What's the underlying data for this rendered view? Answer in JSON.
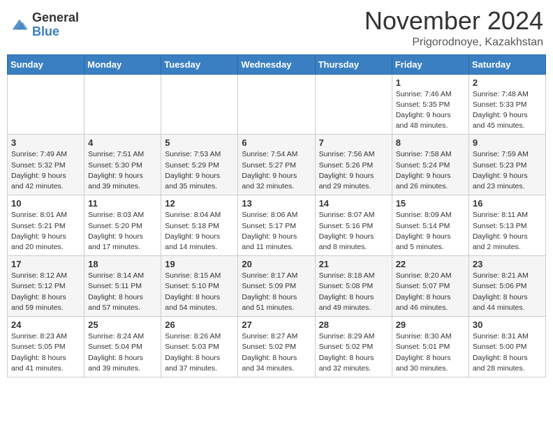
{
  "logo": {
    "general": "General",
    "blue": "Blue"
  },
  "title": "November 2024",
  "location": "Prigorodnoye, Kazakhstan",
  "days_of_week": [
    "Sunday",
    "Monday",
    "Tuesday",
    "Wednesday",
    "Thursday",
    "Friday",
    "Saturday"
  ],
  "weeks": [
    [
      {
        "day": "",
        "info": ""
      },
      {
        "day": "",
        "info": ""
      },
      {
        "day": "",
        "info": ""
      },
      {
        "day": "",
        "info": ""
      },
      {
        "day": "",
        "info": ""
      },
      {
        "day": "1",
        "info": "Sunrise: 7:46 AM\nSunset: 5:35 PM\nDaylight: 9 hours and 48 minutes."
      },
      {
        "day": "2",
        "info": "Sunrise: 7:48 AM\nSunset: 5:33 PM\nDaylight: 9 hours and 45 minutes."
      }
    ],
    [
      {
        "day": "3",
        "info": "Sunrise: 7:49 AM\nSunset: 5:32 PM\nDaylight: 9 hours and 42 minutes."
      },
      {
        "day": "4",
        "info": "Sunrise: 7:51 AM\nSunset: 5:30 PM\nDaylight: 9 hours and 39 minutes."
      },
      {
        "day": "5",
        "info": "Sunrise: 7:53 AM\nSunset: 5:29 PM\nDaylight: 9 hours and 35 minutes."
      },
      {
        "day": "6",
        "info": "Sunrise: 7:54 AM\nSunset: 5:27 PM\nDaylight: 9 hours and 32 minutes."
      },
      {
        "day": "7",
        "info": "Sunrise: 7:56 AM\nSunset: 5:26 PM\nDaylight: 9 hours and 29 minutes."
      },
      {
        "day": "8",
        "info": "Sunrise: 7:58 AM\nSunset: 5:24 PM\nDaylight: 9 hours and 26 minutes."
      },
      {
        "day": "9",
        "info": "Sunrise: 7:59 AM\nSunset: 5:23 PM\nDaylight: 9 hours and 23 minutes."
      }
    ],
    [
      {
        "day": "10",
        "info": "Sunrise: 8:01 AM\nSunset: 5:21 PM\nDaylight: 9 hours and 20 minutes."
      },
      {
        "day": "11",
        "info": "Sunrise: 8:03 AM\nSunset: 5:20 PM\nDaylight: 9 hours and 17 minutes."
      },
      {
        "day": "12",
        "info": "Sunrise: 8:04 AM\nSunset: 5:18 PM\nDaylight: 9 hours and 14 minutes."
      },
      {
        "day": "13",
        "info": "Sunrise: 8:06 AM\nSunset: 5:17 PM\nDaylight: 9 hours and 11 minutes."
      },
      {
        "day": "14",
        "info": "Sunrise: 8:07 AM\nSunset: 5:16 PM\nDaylight: 9 hours and 8 minutes."
      },
      {
        "day": "15",
        "info": "Sunrise: 8:09 AM\nSunset: 5:14 PM\nDaylight: 9 hours and 5 minutes."
      },
      {
        "day": "16",
        "info": "Sunrise: 8:11 AM\nSunset: 5:13 PM\nDaylight: 9 hours and 2 minutes."
      }
    ],
    [
      {
        "day": "17",
        "info": "Sunrise: 8:12 AM\nSunset: 5:12 PM\nDaylight: 8 hours and 59 minutes."
      },
      {
        "day": "18",
        "info": "Sunrise: 8:14 AM\nSunset: 5:11 PM\nDaylight: 8 hours and 57 minutes."
      },
      {
        "day": "19",
        "info": "Sunrise: 8:15 AM\nSunset: 5:10 PM\nDaylight: 8 hours and 54 minutes."
      },
      {
        "day": "20",
        "info": "Sunrise: 8:17 AM\nSunset: 5:09 PM\nDaylight: 8 hours and 51 minutes."
      },
      {
        "day": "21",
        "info": "Sunrise: 8:18 AM\nSunset: 5:08 PM\nDaylight: 8 hours and 49 minutes."
      },
      {
        "day": "22",
        "info": "Sunrise: 8:20 AM\nSunset: 5:07 PM\nDaylight: 8 hours and 46 minutes."
      },
      {
        "day": "23",
        "info": "Sunrise: 8:21 AM\nSunset: 5:06 PM\nDaylight: 8 hours and 44 minutes."
      }
    ],
    [
      {
        "day": "24",
        "info": "Sunrise: 8:23 AM\nSunset: 5:05 PM\nDaylight: 8 hours and 41 minutes."
      },
      {
        "day": "25",
        "info": "Sunrise: 8:24 AM\nSunset: 5:04 PM\nDaylight: 8 hours and 39 minutes."
      },
      {
        "day": "26",
        "info": "Sunrise: 8:26 AM\nSunset: 5:03 PM\nDaylight: 8 hours and 37 minutes."
      },
      {
        "day": "27",
        "info": "Sunrise: 8:27 AM\nSunset: 5:02 PM\nDaylight: 8 hours and 34 minutes."
      },
      {
        "day": "28",
        "info": "Sunrise: 8:29 AM\nSunset: 5:02 PM\nDaylight: 8 hours and 32 minutes."
      },
      {
        "day": "29",
        "info": "Sunrise: 8:30 AM\nSunset: 5:01 PM\nDaylight: 8 hours and 30 minutes."
      },
      {
        "day": "30",
        "info": "Sunrise: 8:31 AM\nSunset: 5:00 PM\nDaylight: 8 hours and 28 minutes."
      }
    ]
  ]
}
